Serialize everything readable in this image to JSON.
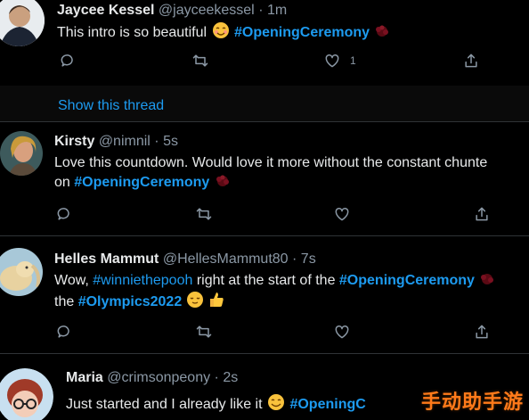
{
  "tweets": [
    {
      "name": "Jaycee Kessel",
      "handle": "@jayceekessel",
      "separator": "·",
      "time": "1m",
      "text_parts": [
        "This intro is so beautiful ",
        "#OpeningCeremony"
      ],
      "actions": {
        "reply": "",
        "retweet": "",
        "like": "1",
        "share": ""
      }
    },
    {
      "name": "Kirsty",
      "handle": "@nimnil",
      "separator": "·",
      "time": "5s",
      "line1": "Love this countdown. Would love it more without the constant chunte",
      "line2_prefix": "on ",
      "line2_hashtag": "#OpeningCeremony"
    },
    {
      "name": "Helles Mammut",
      "handle": "@HellesMammut80",
      "separator": "·",
      "time": "7s",
      "line1_prefix": "Wow, ",
      "line1_mention": "#winniethepooh",
      "line1_mid": " right at the start of the ",
      "line1_hashtag": "#OpeningCeremony",
      "line2_prefix": "the ",
      "line2_hashtag": "#Olympics2022"
    },
    {
      "name": "Maria",
      "handle": "@crimsonpeony",
      "separator": "·",
      "time": "2s",
      "text_prefix": "Just started and I already like it ",
      "text_hashtag": "#OpeningC"
    }
  ],
  "thread": {
    "link": "Show this thread"
  },
  "watermark": "手动助手游",
  "icons": [
    "reply-icon",
    "retweet-icon",
    "like-icon",
    "share-icon"
  ],
  "colors": {
    "background": "#000000",
    "accent": "#1d9bf0",
    "muted": "#8b98a5"
  }
}
